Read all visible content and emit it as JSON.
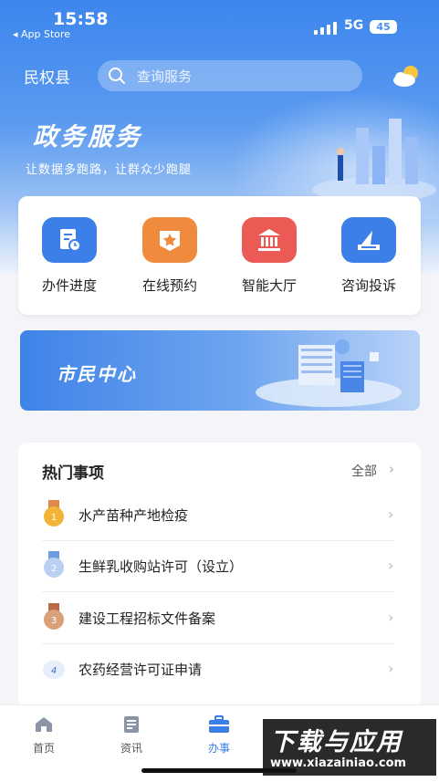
{
  "status_bar": {
    "time": "15:58",
    "back_app": "◂ App Store",
    "network": "5G",
    "battery": "45"
  },
  "header": {
    "county": "民权县",
    "search_placeholder": "查询服务",
    "weather_icon": "partly-cloudy-icon"
  },
  "hero": {
    "title": "政务服务",
    "subtitle": "让数据多跑路，让群众少跑腿"
  },
  "quick_services": [
    {
      "label": "办件进度",
      "icon": "progress-doc-icon",
      "color": "#3d7fe8"
    },
    {
      "label": "在线预约",
      "icon": "star-badge-icon",
      "color": "#f08a3c"
    },
    {
      "label": "智能大厅",
      "icon": "building-icon",
      "color": "#ec5a55"
    },
    {
      "label": "咨询投诉",
      "icon": "inbox-send-icon",
      "color": "#3d7fe8"
    }
  ],
  "banner": {
    "title": "市民中心"
  },
  "hot": {
    "title": "热门事项",
    "all_label": "全部",
    "items": [
      {
        "label": "水产苗种产地检疫",
        "badge": "1",
        "badge_color": "#f1b437"
      },
      {
        "label": "生鲜乳收购站许可（设立）",
        "badge": "2",
        "badge_color": "#8fb2e8"
      },
      {
        "label": "建设工程招标文件备案",
        "badge": "3",
        "badge_color": "#c98a64"
      },
      {
        "label": "农药经营许可证申请",
        "badge": "4",
        "badge_color": "#4a7fd8"
      }
    ]
  },
  "tabs": [
    {
      "label": "首页",
      "icon": "home-icon",
      "active": false
    },
    {
      "label": "资讯",
      "icon": "news-icon",
      "active": false
    },
    {
      "label": "办事",
      "icon": "briefcase-icon",
      "active": true
    }
  ],
  "watermark": {
    "big": "下载与应用",
    "url": "www.xiazainiao.com"
  },
  "colors": {
    "primary": "#3a7fe6",
    "background": "#f3f5f9"
  }
}
